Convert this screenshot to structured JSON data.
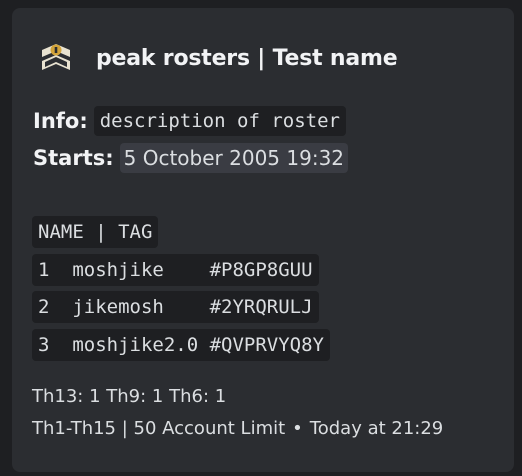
{
  "embed": {
    "author": {
      "name": "peak rosters | Test name",
      "icon": "badge-icon"
    },
    "info": {
      "label": "Info:",
      "value": "description of roster"
    },
    "starts": {
      "label": "Starts:",
      "value": "5 October 2005 19:32"
    },
    "table": {
      "header": "NAME | TAG",
      "rows": [
        "1  moshjike    #P8GP8GUU",
        "2  jikemosh    #2YRQRULJ",
        "3  moshjike2.0 #QVPRVYQ8Y"
      ]
    },
    "summary": "Th13: 1 Th9: 1 Th6: 1",
    "footer": {
      "text": "Th1-Th15 | 50 Account Limit",
      "separator": "•",
      "timestamp": "Today at 21:29"
    }
  },
  "colors": {
    "background": "#1e1f22",
    "embed": "#2b2d31",
    "text": "#dbdee1",
    "heading": "#f2f3f5"
  }
}
